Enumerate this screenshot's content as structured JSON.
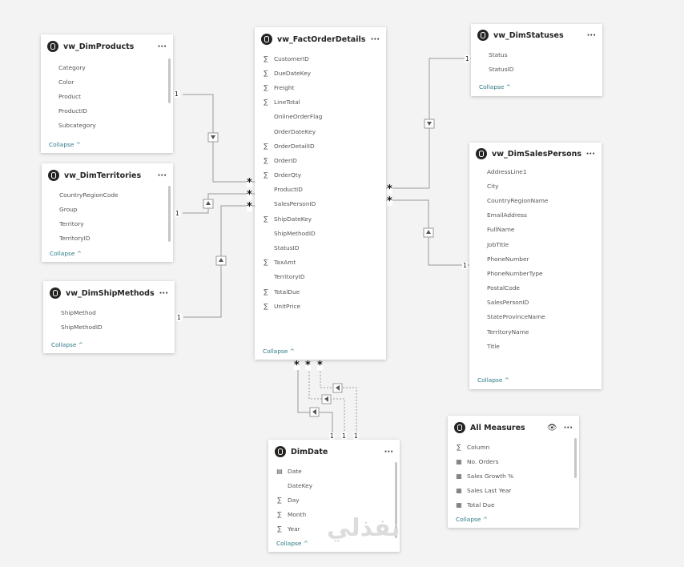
{
  "tables": {
    "products": {
      "title": "vw_DimProducts",
      "more": "···",
      "collapse": "Collapse ^",
      "fields": [
        "Category",
        "Color",
        "Product",
        "ProductID",
        "Subcategory"
      ]
    },
    "territories": {
      "title": "vw_DimTerritories",
      "more": "···",
      "collapse": "Collapse ^",
      "fields": [
        "CountryRegionCode",
        "Group",
        "Territory",
        "TerritoryID"
      ]
    },
    "shipmethods": {
      "title": "vw_DimShipMethods",
      "more": "···",
      "collapse": "Collapse ^",
      "fields": [
        "ShipMethod",
        "ShipMethodID"
      ]
    },
    "fact": {
      "title": "vw_FactOrderDetails",
      "more": "···",
      "collapse": "Collapse ^",
      "fields": [
        "CustomerID",
        "DueDateKey",
        "Freight",
        "LineTotal",
        "OnlineOrderFlag",
        "OrderDateKey",
        "OrderDetailID",
        "OrderID",
        "OrderQty",
        "ProductID",
        "SalesPersonID",
        "ShipDateKey",
        "ShipMethodID",
        "StatusID",
        "TaxAmt",
        "TerritoryID",
        "TotalDue",
        "UnitPrice"
      ],
      "sigma": [
        true,
        true,
        true,
        true,
        false,
        false,
        true,
        true,
        true,
        false,
        false,
        true,
        false,
        false,
        true,
        false,
        true,
        true
      ]
    },
    "statuses": {
      "title": "vw_DimStatuses",
      "more": "···",
      "collapse": "Collapse ^",
      "fields": [
        "Status",
        "StatusID"
      ]
    },
    "salespersons": {
      "title": "vw_DimSalesPersons",
      "more": "···",
      "collapse": "Collapse ^",
      "fields": [
        "AddressLine1",
        "City",
        "CountryRegionName",
        "EmailAddress",
        "FullName",
        "JobTitle",
        "PhoneNumber",
        "PhoneNumberType",
        "PostalCode",
        "SalesPersonID",
        "StateProvinceName",
        "TerritoryName",
        "Title"
      ]
    },
    "dimdate": {
      "title": "DimDate",
      "more": "···",
      "collapse": "Collapse ^",
      "fields": [
        "Date",
        "DateKey",
        "Day",
        "Month",
        "Year"
      ],
      "icons": [
        "calendar",
        "none",
        "sigma",
        "sigma",
        "sigma"
      ]
    },
    "measures": {
      "title": "All Measures",
      "more": "···",
      "eye": "👁",
      "collapse": "Collapse ^",
      "fields": [
        "Column",
        "No. Orders",
        "Sales Growth %",
        "Sales Last Year",
        "Total Due"
      ],
      "icons": [
        "sigma",
        "calc",
        "calc",
        "calc",
        "calc"
      ]
    }
  },
  "cardinality": {
    "one": "1",
    "many": "*"
  },
  "watermark": "نفذلي",
  "colors": {
    "collapse": "#2d7a84",
    "background": "#f3f3f3",
    "line": "#8a8886"
  }
}
